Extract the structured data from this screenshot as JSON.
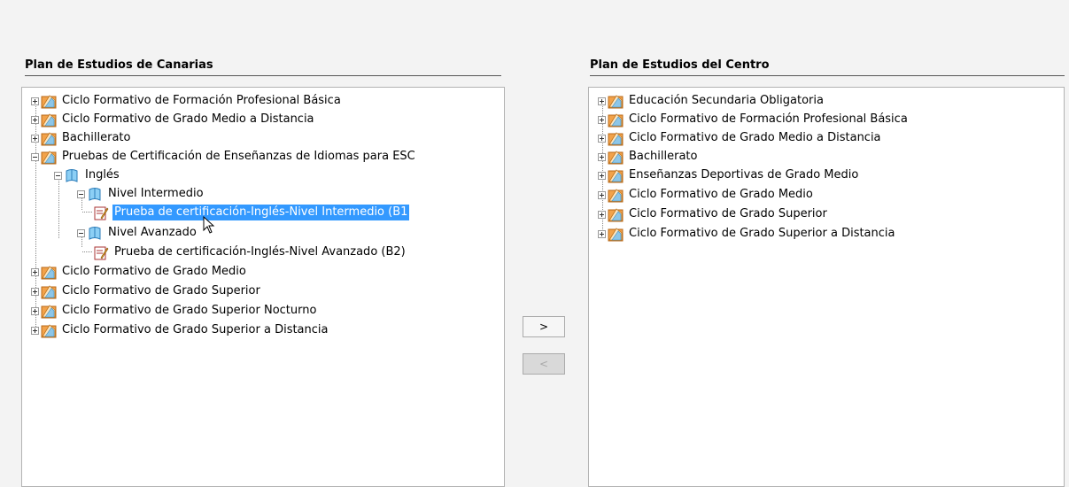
{
  "left_panel": {
    "title": "Plan de Estudios de Canarias",
    "items": [
      "Ciclo Formativo de Formación Profesional Básica",
      "Ciclo Formativo de Grado Medio a Distancia",
      "Bachillerato",
      "Pruebas de Certificación de Enseñanzas de Idiomas para ESC",
      "Inglés",
      "Nivel Intermedio",
      "Prueba de certificación-Inglés-Nivel Intermedio (B1",
      "Nivel Avanzado",
      "Prueba de certificación-Inglés-Nivel Avanzado (B2)",
      "Ciclo Formativo de Grado Medio",
      "Ciclo Formativo de Grado Superior",
      "Ciclo Formativo de Grado Superior Nocturno",
      "Ciclo Formativo de Grado Superior a Distancia"
    ]
  },
  "right_panel": {
    "title": "Plan de Estudios del Centro",
    "items": [
      "Educación Secundaria Obligatoria",
      "Ciclo Formativo de Formación Profesional Básica",
      "Ciclo Formativo de Grado Medio a Distancia",
      "Bachillerato",
      "Enseñanzas Deportivas de Grado Medio",
      "Ciclo Formativo de Grado Medio",
      "Ciclo Formativo de Grado Superior",
      "Ciclo Formativo de Grado Superior a Distancia"
    ]
  },
  "buttons": {
    "add_label": ">",
    "remove_label": "<"
  }
}
